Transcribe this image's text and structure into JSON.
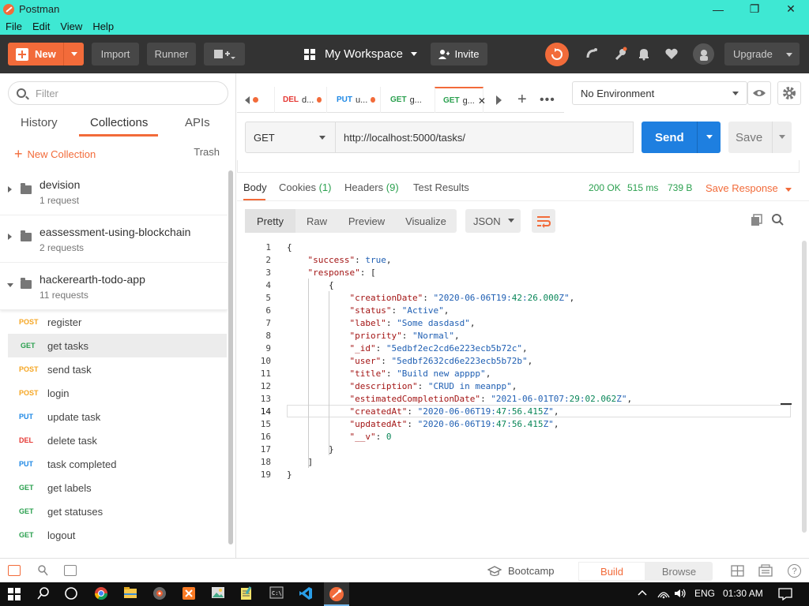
{
  "window": {
    "title": "Postman",
    "minimize": "—",
    "maximize": "❐",
    "close": "✕"
  },
  "menu": [
    "File",
    "Edit",
    "View",
    "Help"
  ],
  "header": {
    "new_label": "New",
    "import_label": "Import",
    "runner_label": "Runner",
    "workspace_label": "My Workspace",
    "invite_label": "Invite",
    "upgrade_label": "Upgrade",
    "colors": {
      "header_bg": "#333333",
      "accent": "#f26b3a"
    }
  },
  "sidebar": {
    "filter_placeholder": "Filter",
    "tabs": [
      "History",
      "Collections",
      "APIs"
    ],
    "new_collection": "New Collection",
    "trash": "Trash",
    "collections": [
      {
        "name": "devision",
        "count": "1 request"
      },
      {
        "name": "eassessment-using-blockchain",
        "count": "2 requests"
      },
      {
        "name": "hackerearth-todo-app",
        "count": "11 requests"
      }
    ],
    "requests": [
      {
        "method": "POST",
        "name": "register"
      },
      {
        "method": "GET",
        "name": "get tasks"
      },
      {
        "method": "POST",
        "name": "send task"
      },
      {
        "method": "POST",
        "name": "login"
      },
      {
        "method": "PUT",
        "name": "update task"
      },
      {
        "method": "DEL",
        "name": "delete task"
      },
      {
        "method": "PUT",
        "name": "task completed"
      },
      {
        "method": "GET",
        "name": "get labels"
      },
      {
        "method": "GET",
        "name": "get statuses"
      },
      {
        "method": "GET",
        "name": "logout"
      }
    ]
  },
  "tabs": [
    {
      "method": "DEL",
      "label": "d..."
    },
    {
      "method": "PUT",
      "label": "u..."
    },
    {
      "method": "GET",
      "label": "g..."
    },
    {
      "method": "GET",
      "label": "g..."
    }
  ],
  "environment": {
    "selected": "No Environment"
  },
  "request": {
    "method": "GET",
    "url": "http://localhost:5000/tasks/",
    "send_label": "Send",
    "save_label": "Save"
  },
  "response": {
    "tabs": {
      "body": "Body",
      "cookies": "Cookies",
      "cookies_count": "(1)",
      "headers": "Headers",
      "headers_count": "(9)",
      "tests": "Test Results"
    },
    "status": "200 OK",
    "time": "515 ms",
    "size": "739 B",
    "save_response": "Save Response",
    "views": [
      "Pretty",
      "Raw",
      "Preview",
      "Visualize"
    ],
    "format": "JSON"
  },
  "code_lines": [
    "{",
    "    \"success\": true,",
    "    \"response\": [",
    "        {",
    "            \"creationDate\": \"2020-06-06T19:42:26.000Z\",",
    "            \"status\": \"Active\",",
    "            \"label\": \"Some dasdasd\",",
    "            \"priority\": \"Normal\",",
    "            \"_id\": \"5edbf2ec2cd6e223ecb5b72c\",",
    "            \"user\": \"5edbf2632cd6e223ecb5b72b\",",
    "            \"title\": \"Build new apppp\",",
    "            \"description\": \"CRUD in meanpp\",",
    "            \"estimatedCompletionDate\": \"2021-06-01T07:29:02.062Z\",",
    "            \"createdAt\": \"2020-06-06T19:47:56.415Z\",",
    "            \"updatedAt\": \"2020-06-06T19:47:56.415Z\",",
    "            \"__v\": 0",
    "        }",
    "    ]",
    "}"
  ],
  "bottom": {
    "bootcamp": "Bootcamp",
    "build": "Build",
    "browse": "Browse"
  },
  "taskbar": {
    "lang": "ENG",
    "time": "01:30 AM"
  }
}
